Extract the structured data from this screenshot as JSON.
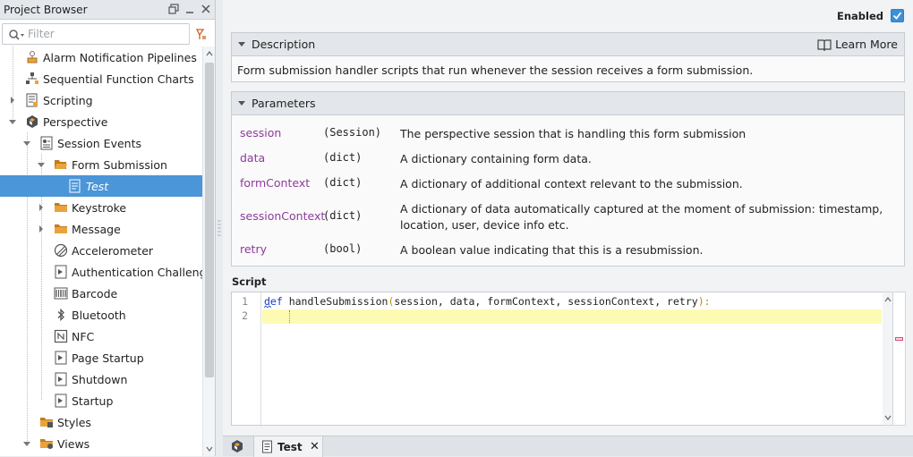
{
  "project_browser": {
    "title": "Project Browser",
    "filter_placeholder": "Filter",
    "tree": [
      {
        "label": "Alarm Notification Pipelines",
        "icon": "pipeline-icon"
      },
      {
        "label": "Sequential Function Charts",
        "icon": "sfc-icon"
      },
      {
        "label": "Scripting",
        "icon": "script-icon"
      },
      {
        "label": "Perspective",
        "icon": "perspective-icon"
      },
      {
        "label": "Session Events",
        "icon": "session-events-icon"
      },
      {
        "label": "Form Submission",
        "icon": "folder-open-icon"
      },
      {
        "label": "Test",
        "icon": "script-file-icon"
      },
      {
        "label": "Keystroke",
        "icon": "folder-icon"
      },
      {
        "label": "Message",
        "icon": "folder-icon"
      },
      {
        "label": "Accelerometer",
        "icon": "accelerometer-icon"
      },
      {
        "label": "Authentication Challenge",
        "icon": "script-page-icon"
      },
      {
        "label": "Barcode",
        "icon": "barcode-icon"
      },
      {
        "label": "Bluetooth",
        "icon": "bluetooth-icon"
      },
      {
        "label": "NFC",
        "icon": "nfc-icon"
      },
      {
        "label": "Page Startup",
        "icon": "script-page-icon"
      },
      {
        "label": "Shutdown",
        "icon": "script-page-icon"
      },
      {
        "label": "Startup",
        "icon": "script-page-icon"
      },
      {
        "label": "Styles",
        "icon": "styles-folder-icon"
      },
      {
        "label": "Views",
        "icon": "views-folder-icon"
      }
    ]
  },
  "enabled": {
    "label": "Enabled",
    "checked": true
  },
  "description": {
    "header": "Description",
    "learn_more": "Learn More",
    "text": "Form submission handler scripts that run whenever the session receives a form submission."
  },
  "parameters": {
    "header": "Parameters",
    "rows": [
      {
        "name": "session",
        "type": "(Session)",
        "desc": "The perspective session that is handling this form submission"
      },
      {
        "name": "data",
        "type": "(dict)",
        "desc": "A dictionary containing form data."
      },
      {
        "name": "formContext",
        "type": "(dict)",
        "desc": "A dictionary of additional context relevant to the submission."
      },
      {
        "name": "sessionContext",
        "type": "(dict)",
        "desc": "A dictionary of data automatically captured at the moment of submission: timestamp, location, user, device info etc."
      },
      {
        "name": "retry",
        "type": "(bool)",
        "desc": "A boolean value indicating that this is a resubmission."
      }
    ]
  },
  "script": {
    "label": "Script",
    "line_numbers": [
      "1",
      "2"
    ],
    "kw_def": "def",
    "func_sig": " handleSubmission",
    "open_paren": "(",
    "args": "session, data, formContext, sessionContext, retry",
    "close": "):"
  },
  "tabs": {
    "active_label": "Test",
    "close": "✕"
  }
}
